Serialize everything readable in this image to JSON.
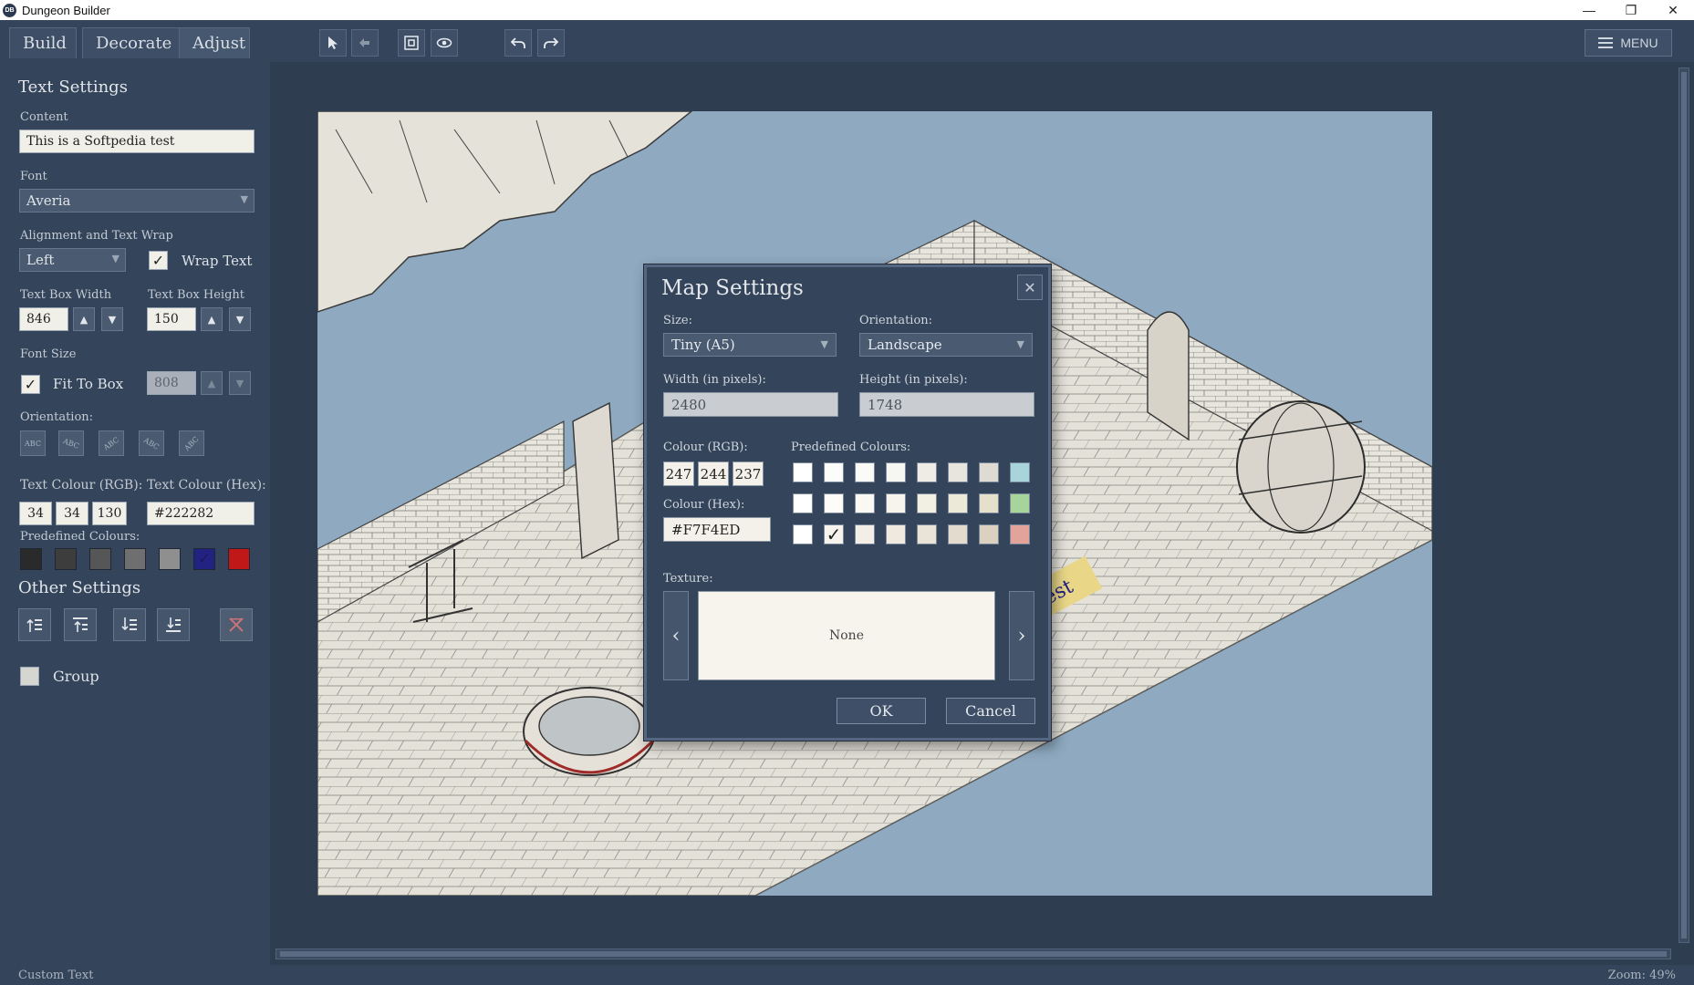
{
  "window": {
    "title": "Dungeon Builder",
    "app_icon": "DB",
    "controls": [
      "—",
      "❐",
      "✕"
    ]
  },
  "tabs": [
    {
      "label": "Build",
      "active": false
    },
    {
      "label": "Decorate",
      "active": false
    },
    {
      "label": "Adjust",
      "active": true
    }
  ],
  "toolbar": {
    "tools": [
      "select-arrow-icon",
      "hand-pan-icon",
      "fit-view-icon",
      "eye-icon",
      "undo-icon",
      "redo-icon"
    ],
    "menu_label": "MENU"
  },
  "text_settings": {
    "heading": "Text Settings",
    "content_label": "Content",
    "content_value": "This is a Softpedia test",
    "font_label": "Font",
    "font_value": "Averia",
    "alignment_label": "Alignment and Text Wrap",
    "alignment_value": "Left",
    "wrap_text_label": "Wrap Text",
    "wrap_text_checked": true,
    "width_label": "Text Box Width",
    "width_value": "846",
    "height_label": "Text Box Height",
    "height_value": "150",
    "font_size_label": "Font Size",
    "fit_to_box_label": "Fit To Box",
    "fit_to_box_checked": true,
    "font_size_value": "808",
    "orientation_label": "Orientation:",
    "orientation_glyph": "ABC",
    "text_colour_rgb_label": "Text Colour (RGB):",
    "text_colour_hex_label": "Text Colour (Hex):",
    "rgb": [
      "34",
      "34",
      "130"
    ],
    "hex": "#222282",
    "predefined_label": "Predefined Colours:",
    "swatches": [
      "#2a2a2a",
      "#3d3d3d",
      "#565656",
      "#6f6f6f",
      "#8f8f8f",
      "#222282",
      "#c01818"
    ],
    "selected_swatch": 5
  },
  "other_settings": {
    "heading": "Other Settings",
    "buttons": [
      "bring-to-front-icon",
      "bring-forward-icon",
      "send-backward-icon",
      "send-to-back-icon",
      "delete-icon"
    ],
    "group_label": "Group",
    "group_checked": false
  },
  "map": {
    "label_text": "test",
    "water_color": "#8ea9c0",
    "floor_color": "#e4e1d9"
  },
  "dialog": {
    "title": "Map Settings",
    "close_glyph": "✕",
    "size_label": "Size:",
    "size_value": "Tiny (A5)",
    "orientation_label": "Orientation:",
    "orientation_value": "Landscape",
    "width_label": "Width (in pixels):",
    "width_value": "2480",
    "height_label": "Height (in pixels):",
    "height_value": "1748",
    "colour_rgb_label": "Colour (RGB):",
    "rgb": [
      "247",
      "244",
      "237"
    ],
    "colour_hex_label": "Colour (Hex):",
    "hex": "#F7F4ED",
    "predefined_label": "Predefined Colours:",
    "palette": [
      [
        "#ffffff",
        "#fcfcfb",
        "#fafaf7",
        "#f6f6f2",
        "#efece6",
        "#e8e5de",
        "#dedbd3",
        "#a8d4dc"
      ],
      [
        "#ffffff",
        "#fdfcf8",
        "#faf8f2",
        "#f7f4ed",
        "#f2efe3",
        "#ede9d8",
        "#e4e0cc",
        "#a6d49a"
      ],
      [
        "#ffffff",
        "#f7f4ed",
        "#f3efe6",
        "#efe9df",
        "#eae3d7",
        "#e3dbcd",
        "#dad1c1",
        "#e2a39a"
      ]
    ],
    "selected_palette": [
      2,
      1
    ],
    "texture_label": "Texture:",
    "texture_value": "None",
    "ok_label": "OK",
    "cancel_label": "Cancel"
  },
  "status": {
    "left": "Custom Text",
    "right": "Zoom: 49%"
  }
}
